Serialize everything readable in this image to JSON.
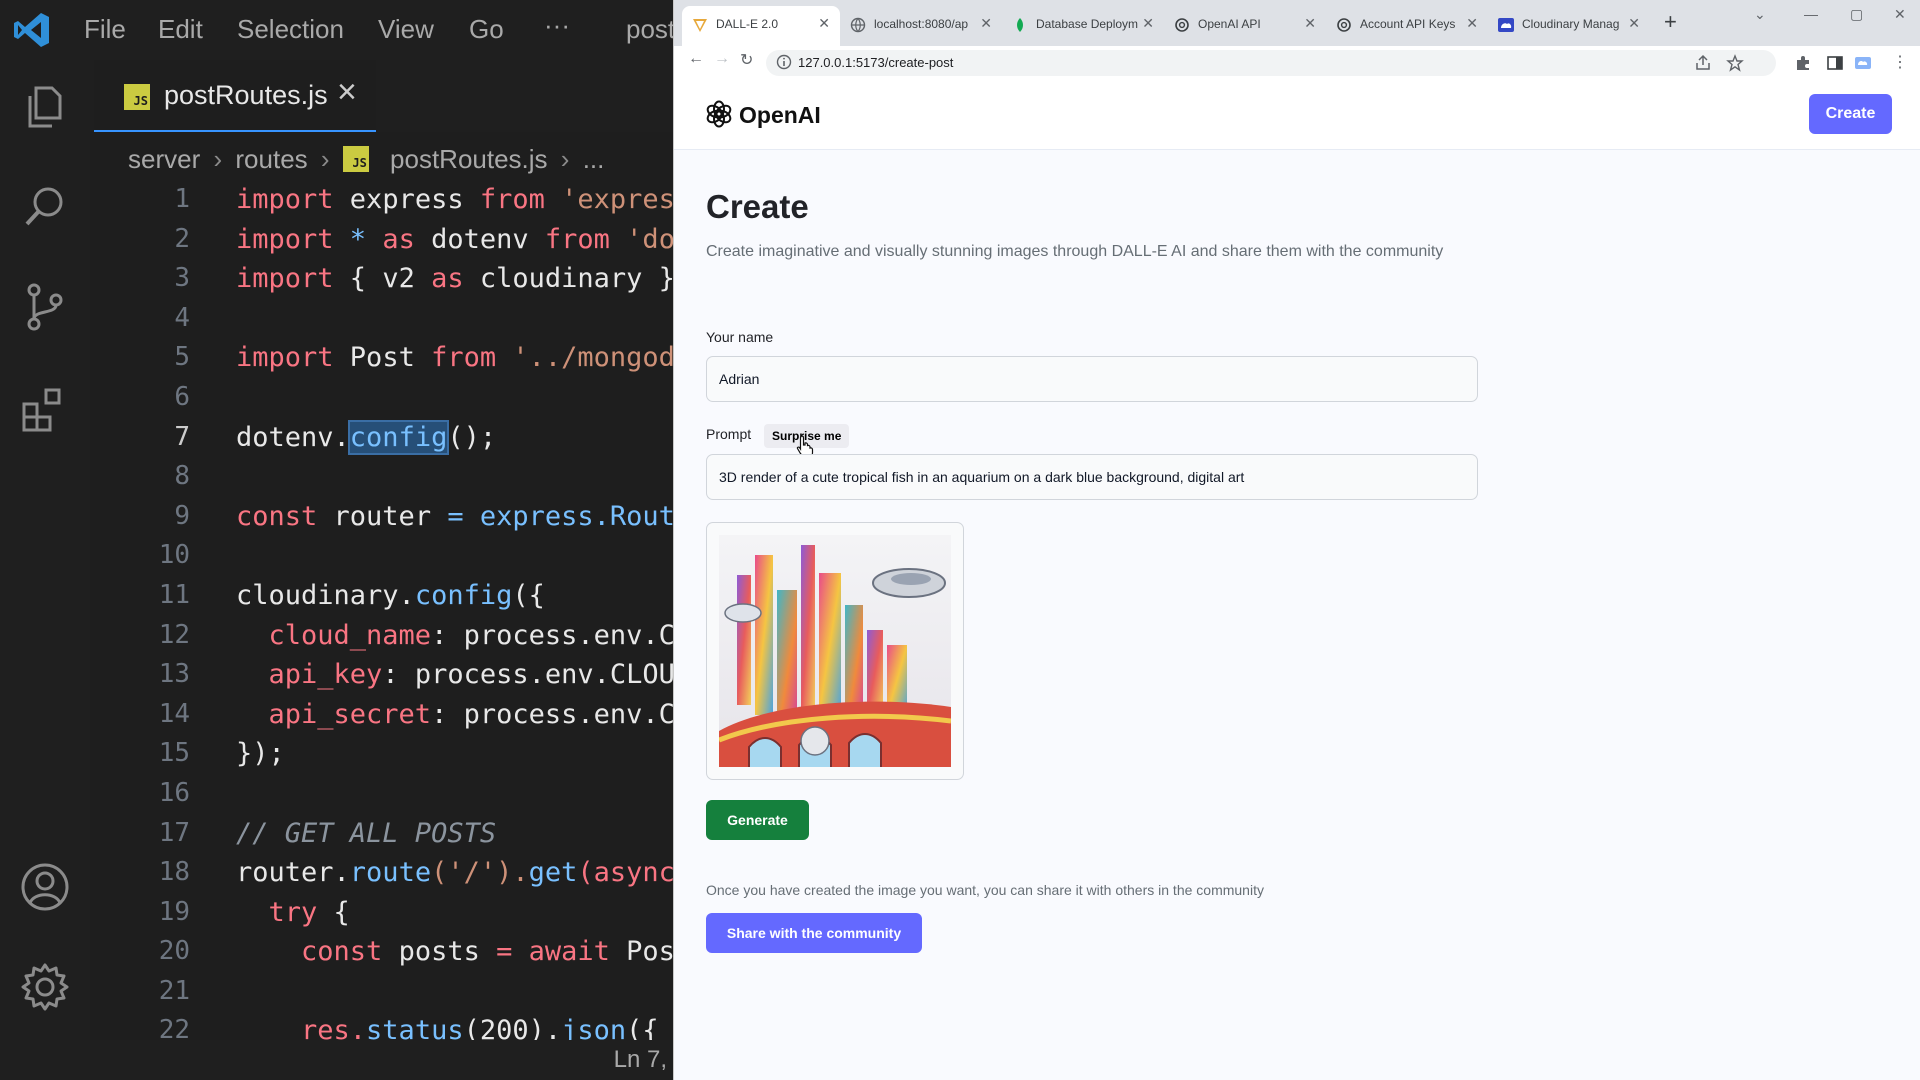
{
  "vscode": {
    "menu": [
      "File",
      "Edit",
      "Selection",
      "View",
      "Go",
      "···",
      "post"
    ],
    "tab": {
      "label": "postRoutes.js",
      "badge": "JS"
    },
    "breadcrumb": [
      "server",
      "routes",
      "postRoutes.js",
      "..."
    ],
    "line_numbers": [
      "1",
      "2",
      "3",
      "4",
      "5",
      "6",
      "7",
      "8",
      "9",
      "10",
      "11",
      "12",
      "13",
      "14",
      "15",
      "16",
      "17",
      "18",
      "19",
      "20",
      "21",
      "22"
    ],
    "active_line": "7",
    "code": {
      "l1": {
        "a": "import",
        "b": " express ",
        "c": "from",
        "d": " 'expres"
      },
      "l2": {
        "a": "import",
        "b": " * ",
        "c": "as",
        "d": " dotenv ",
        "e": "from",
        "f": " 'do"
      },
      "l3": {
        "a": "import",
        "b": " { v2 ",
        "c": "as",
        "d": " cloudinary }"
      },
      "l5": {
        "a": "import",
        "b": " Post ",
        "c": "from",
        "d": " '../mongod"
      },
      "l7": {
        "a": "dotenv.",
        "b": "config",
        "c": "();"
      },
      "l9": {
        "a": "const",
        "b": " router ",
        "c": "= ",
        "d": "express.Rout"
      },
      "l11": {
        "a": "cloudinary.",
        "b": "config",
        "c": "({"
      },
      "l12": {
        "a": "  cloud_name",
        "b": ": process.env.C"
      },
      "l13": {
        "a": "  api_key",
        "b": ": process.env.CLOU"
      },
      "l14": {
        "a": "  api_secret",
        "b": ": process.env.C"
      },
      "l15": {
        "a": "});"
      },
      "l17": {
        "a": "// GET ALL POSTS"
      },
      "l18": {
        "a": "router.",
        "b": "route",
        "c": "('/').",
        "d": "get",
        "e": "(async"
      },
      "l19": {
        "a": "  try",
        "b": " {"
      },
      "l20": {
        "a": "    const",
        "b": " posts ",
        "c": "= ",
        "d": "await",
        "e": " Pos"
      },
      "l22": {
        "a": "    res.",
        "b": "status",
        "c": "(200).",
        "d": "json",
        "e": "({"
      }
    },
    "status": "Ln 7,"
  },
  "browser": {
    "tabs": [
      {
        "title": "DALL-E 2.0",
        "icon": "dalle-favicon"
      },
      {
        "title": "localhost:8080/ap",
        "icon": "globe-favicon"
      },
      {
        "title": "Database Deploym",
        "icon": "mongodb-favicon"
      },
      {
        "title": "OpenAI API",
        "icon": "openai-favicon"
      },
      {
        "title": "Account API Keys",
        "icon": "openai-favicon"
      },
      {
        "title": "Cloudinary Manag",
        "icon": "cloudinary-favicon"
      }
    ],
    "url": "127.0.0.1:5173/create-post"
  },
  "app": {
    "logo_text": "OpenAI",
    "header_create": "Create",
    "title": "Create",
    "subtitle": "Create imaginative and visually stunning images through DALL-E AI and share them with the community",
    "name_label": "Your name",
    "name_value": "Adrian",
    "prompt_label": "Prompt",
    "surprise_label": "Surprise me",
    "prompt_value": "3D render of a cute tropical fish in an aquarium on a dark blue background, digital art",
    "generate_label": "Generate",
    "share_note": "Once you have created the image you want, you can share it with others in the community",
    "share_label": "Share with the community",
    "colors": {
      "primary": "#6469ff",
      "generate": "#15803d"
    }
  }
}
